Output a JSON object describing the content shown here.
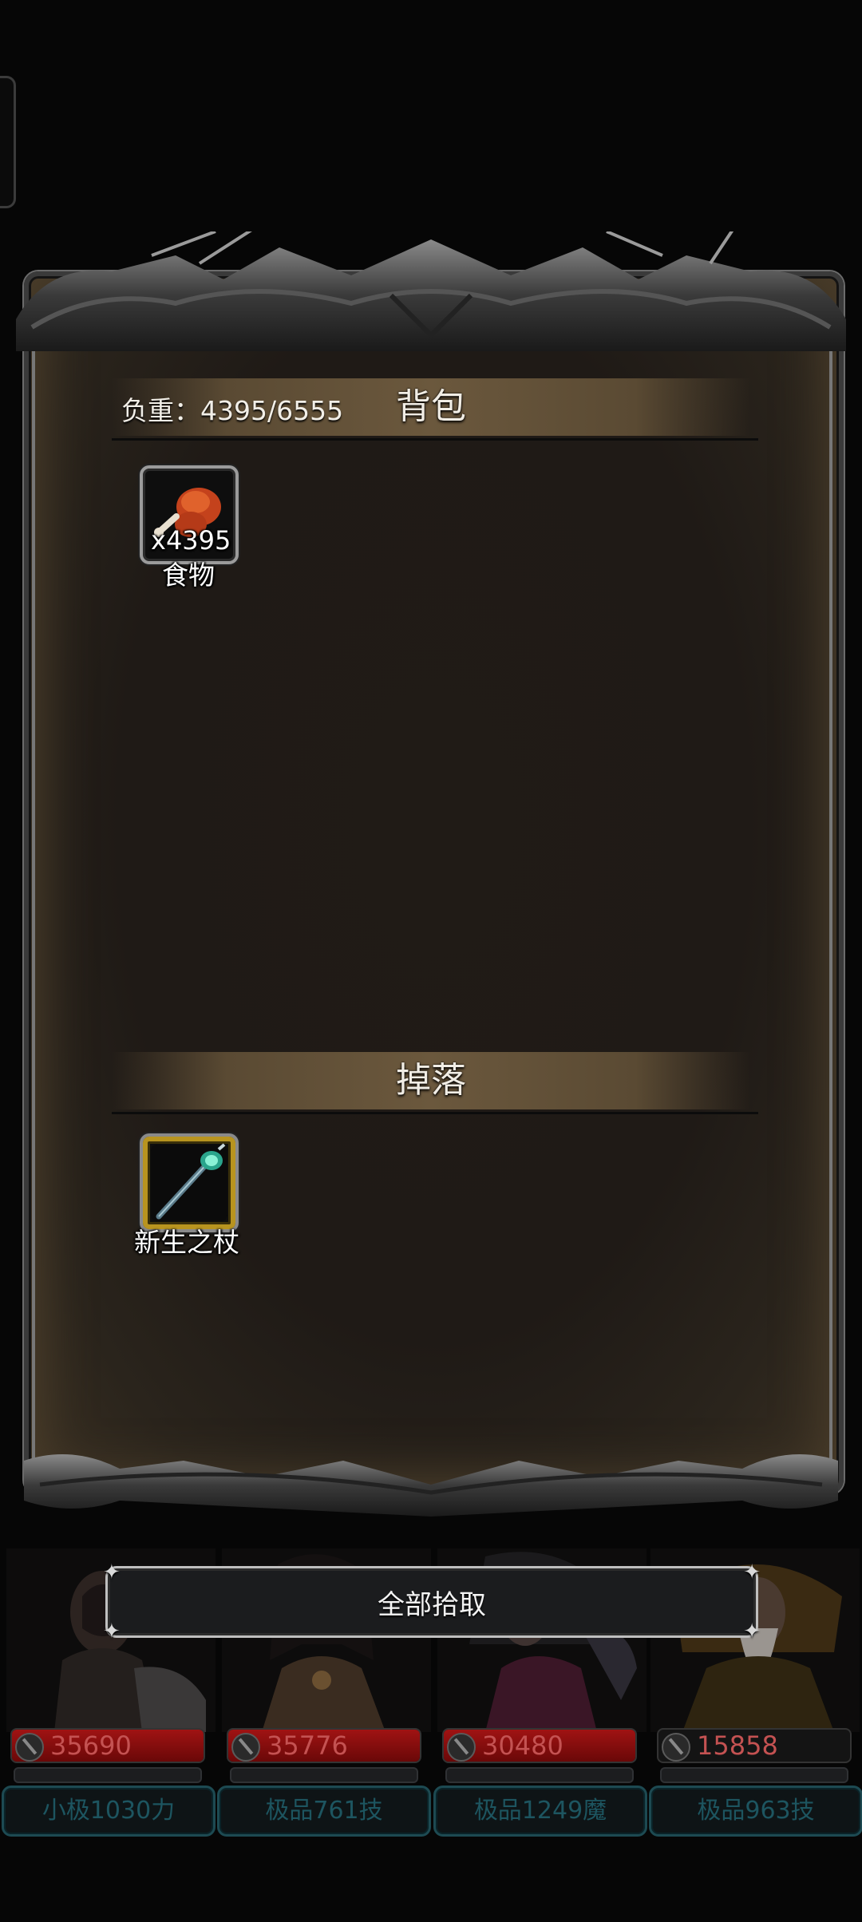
{
  "bag": {
    "title": "背包",
    "weight_label": "负重：4395/6555",
    "items": [
      {
        "name": "食物",
        "count": "x4395",
        "icon": "drumstick-icon"
      }
    ]
  },
  "drops": {
    "title": "掉落",
    "items": [
      {
        "name": "新生之杖",
        "icon": "staff-icon",
        "rarity_color": "#b8941f"
      }
    ]
  },
  "pickup_all_label": "全部拾取",
  "heroes": [
    {
      "hp": "35690",
      "tag": "小极1030力",
      "hp_fill": 1.0
    },
    {
      "hp": "35776",
      "tag": "极品761技",
      "hp_fill": 1.0
    },
    {
      "hp": "30480",
      "tag": "极品1249魔",
      "hp_fill": 1.0
    },
    {
      "hp": "15858",
      "tag": "极品963技",
      "hp_fill": 0.0
    }
  ],
  "colors": {
    "panel": "#1f1a16",
    "header": "#6b583d",
    "hp": "#a01313",
    "tag_text": "#1d5560"
  }
}
